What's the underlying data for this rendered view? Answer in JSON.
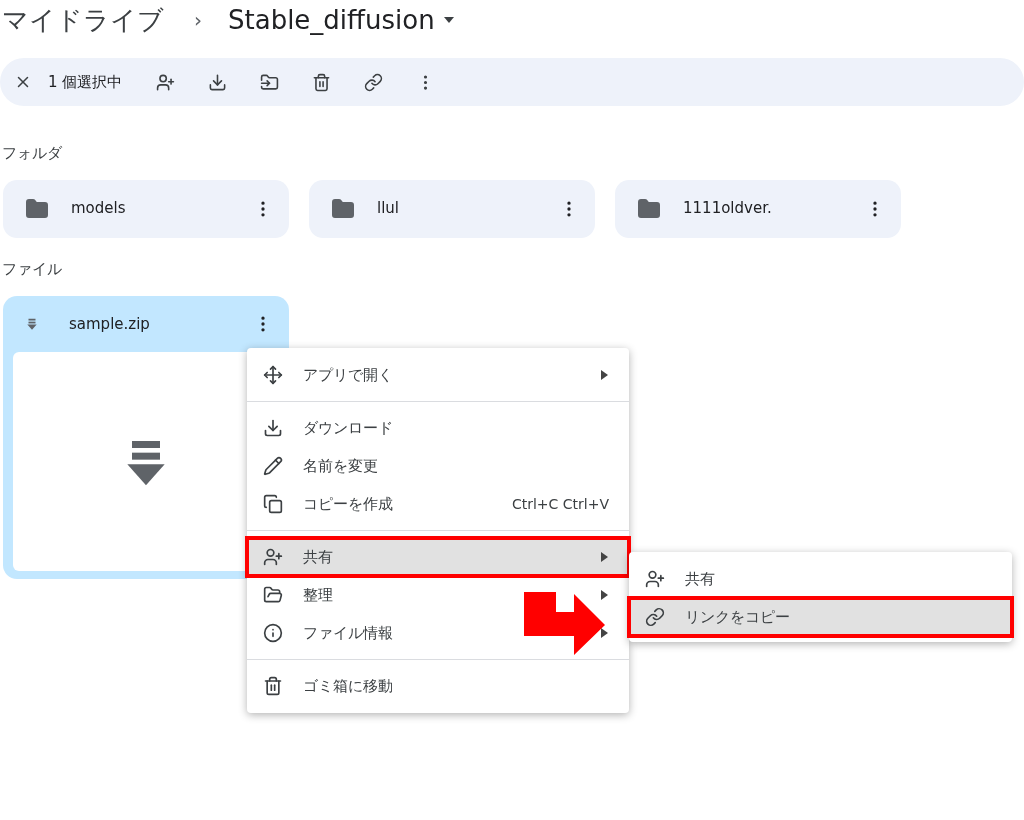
{
  "breadcrumb": {
    "root": "マイドライブ",
    "separator": "›",
    "current": "Stable_diffusion"
  },
  "selection_bar": {
    "count_text": "1 個選択中"
  },
  "folders_section": {
    "heading": "フォルダ",
    "folders": [
      {
        "name": "models"
      },
      {
        "name": "llul"
      },
      {
        "name": "1111oldver."
      }
    ]
  },
  "files_section": {
    "heading": "ファイル",
    "files": [
      {
        "name": "sample.zip",
        "selected": true
      }
    ]
  },
  "context_menu": {
    "groups": [
      [
        {
          "label": "アプリで開く",
          "submenu": true,
          "selected": false,
          "annotated": false
        }
      ],
      [
        {
          "label": "ダウンロード",
          "submenu": false,
          "selected": false,
          "annotated": false
        },
        {
          "label": "名前を変更",
          "submenu": false,
          "selected": false,
          "annotated": false
        },
        {
          "label": "コピーを作成",
          "shortcut": "Ctrl+C Ctrl+V",
          "submenu": false,
          "selected": false,
          "annotated": false
        }
      ],
      [
        {
          "label": "共有",
          "submenu": true,
          "selected": true,
          "annotated": true
        },
        {
          "label": "整理",
          "submenu": true,
          "selected": false,
          "annotated": false
        },
        {
          "label": "ファイル情報",
          "submenu": true,
          "selected": false,
          "annotated": false
        }
      ],
      [
        {
          "label": "ゴミ箱に移動",
          "submenu": false,
          "selected": false,
          "annotated": false
        }
      ]
    ]
  },
  "submenu": {
    "items": [
      {
        "label": "共有",
        "selected": false,
        "annotated": false
      },
      {
        "label": "リンクをコピー",
        "selected": true,
        "annotated": true
      }
    ]
  }
}
